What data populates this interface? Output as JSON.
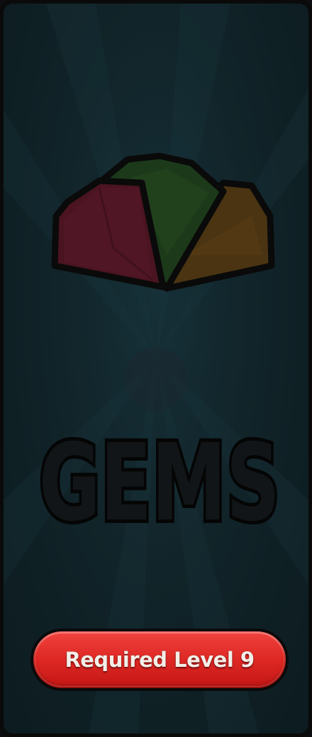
{
  "screen": {
    "title": "GEMS",
    "locked": true
  },
  "colors": {
    "panel_background": "#112429",
    "gem_red": "#4a1420",
    "gem_green": "#1c3a1a",
    "gem_orange": "#4a3412",
    "button_red": "#e02a26",
    "button_text": "#f3efe8"
  },
  "icons": {
    "gem_art": "gems-icon"
  },
  "button": {
    "label": "Required Level 9"
  }
}
